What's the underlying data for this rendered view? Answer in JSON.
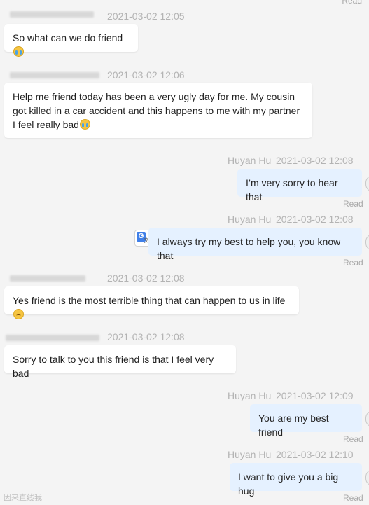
{
  "top_read": "Read",
  "messages": [
    {
      "dir": "in",
      "time": "2021-03-02 12:05",
      "text": "So what can we do friend",
      "emoji": "cry"
    },
    {
      "dir": "in",
      "time": "2021-03-02 12:06",
      "text": "Help me friend today has been a very ugly day for me. My cousin got killed in a car accident and this happens to me with my partner I feel really bad",
      "emoji": "cry"
    },
    {
      "dir": "out",
      "sender": "Huyan Hu",
      "time": "2021-03-02 12:08",
      "text": "I’m very sorry to hear that",
      "status": "Read"
    },
    {
      "dir": "out",
      "sender": "Huyan Hu",
      "time": "2021-03-02 12:08",
      "text": "I always try my best to help you, you know that",
      "status": "Read",
      "translate": true
    },
    {
      "dir": "in",
      "time": "2021-03-02 12:08",
      "text": "Yes friend is the most terrible thing that can happen to us in life",
      "emoji": "sad"
    },
    {
      "dir": "in",
      "time": "2021-03-02 12:08",
      "text": "Sorry to talk to you this friend is that I feel very bad"
    },
    {
      "dir": "out",
      "sender": "Huyan Hu",
      "time": "2021-03-02 12:09",
      "text": "You are my best friend",
      "status": "Read"
    },
    {
      "dir": "out",
      "sender": "Huyan Hu",
      "time": "2021-03-02 12:10",
      "text": "I want to give you a big hug",
      "status": "Read"
    }
  ],
  "watermark": "因来直线我"
}
